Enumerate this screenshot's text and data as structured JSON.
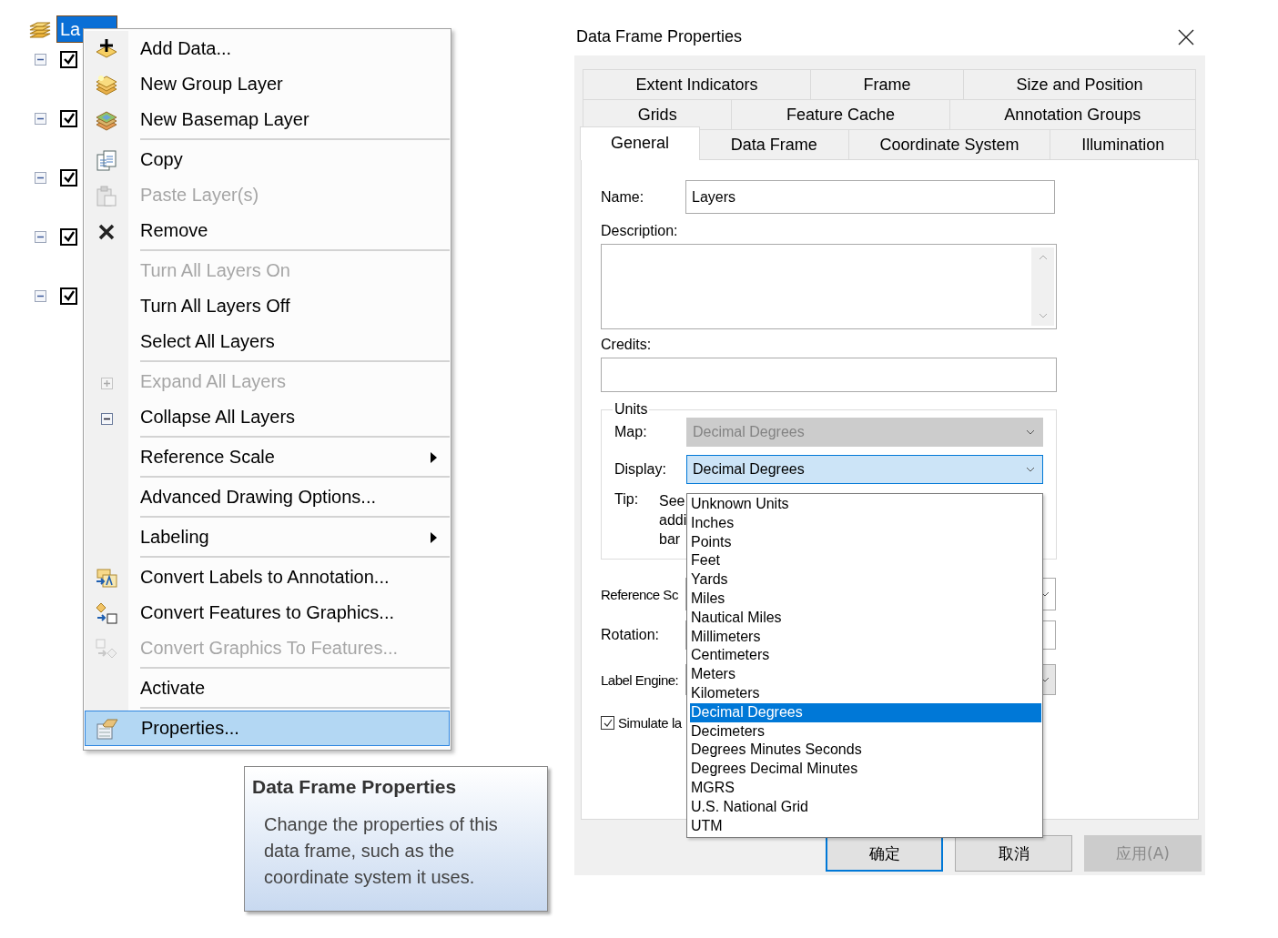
{
  "tree": {
    "root": {
      "label": "La",
      "selected": true
    },
    "layers": [
      {
        "expanded": true,
        "checked": true
      },
      {
        "expanded": true,
        "checked": true
      },
      {
        "expanded": true,
        "checked": true
      },
      {
        "expanded": true,
        "checked": true
      },
      {
        "expanded": true,
        "checked": true
      }
    ]
  },
  "context_menu": {
    "items": [
      {
        "kind": "item",
        "label": "Add Data...",
        "disabled": false,
        "selected": false,
        "submenu": false
      },
      {
        "kind": "item",
        "label": "New Group Layer",
        "disabled": false,
        "selected": false,
        "submenu": false
      },
      {
        "kind": "item",
        "label": "New Basemap Layer",
        "disabled": false,
        "selected": false,
        "submenu": false
      },
      {
        "kind": "separator"
      },
      {
        "kind": "item",
        "label": "Copy",
        "disabled": false,
        "selected": false,
        "submenu": false
      },
      {
        "kind": "item",
        "label": "Paste Layer(s)",
        "disabled": true,
        "selected": false,
        "submenu": false
      },
      {
        "kind": "item",
        "label": "Remove",
        "disabled": false,
        "selected": false,
        "submenu": false
      },
      {
        "kind": "separator"
      },
      {
        "kind": "item",
        "label": "Turn All Layers On",
        "disabled": true,
        "selected": false,
        "submenu": false
      },
      {
        "kind": "item",
        "label": "Turn All Layers Off",
        "disabled": false,
        "selected": false,
        "submenu": false
      },
      {
        "kind": "item",
        "label": "Select All Layers",
        "disabled": false,
        "selected": false,
        "submenu": false
      },
      {
        "kind": "separator"
      },
      {
        "kind": "item",
        "label": "Expand All Layers",
        "disabled": true,
        "selected": false,
        "submenu": false
      },
      {
        "kind": "item",
        "label": "Collapse All Layers",
        "disabled": false,
        "selected": false,
        "submenu": false
      },
      {
        "kind": "separator"
      },
      {
        "kind": "item",
        "label": "Reference Scale",
        "disabled": false,
        "selected": false,
        "submenu": true
      },
      {
        "kind": "separator"
      },
      {
        "kind": "item",
        "label": "Advanced Drawing Options...",
        "disabled": false,
        "selected": false,
        "submenu": false
      },
      {
        "kind": "separator"
      },
      {
        "kind": "item",
        "label": "Labeling",
        "disabled": false,
        "selected": false,
        "submenu": true
      },
      {
        "kind": "separator"
      },
      {
        "kind": "item",
        "label": "Convert Labels to Annotation...",
        "disabled": false,
        "selected": false,
        "submenu": false
      },
      {
        "kind": "item",
        "label": "Convert Features to Graphics...",
        "disabled": false,
        "selected": false,
        "submenu": false
      },
      {
        "kind": "item",
        "label": "Convert Graphics To Features...",
        "disabled": true,
        "selected": false,
        "submenu": false
      },
      {
        "kind": "separator"
      },
      {
        "kind": "item",
        "label": "Activate",
        "disabled": false,
        "selected": false,
        "submenu": false
      },
      {
        "kind": "separator"
      },
      {
        "kind": "item",
        "label": "Properties...",
        "disabled": false,
        "selected": true,
        "submenu": false
      }
    ]
  },
  "tooltip": {
    "title": "Data Frame Properties",
    "text": "Change the properties of this data frame, such as the coordinate system it uses."
  },
  "dialog": {
    "title": "Data Frame Properties",
    "tab_rows": [
      [
        {
          "label": "Extent Indicators",
          "selected": false
        },
        {
          "label": "Frame",
          "selected": false
        },
        {
          "label": "Size and Position",
          "selected": false
        }
      ],
      [
        {
          "label": "Grids",
          "selected": false
        },
        {
          "label": "Feature Cache",
          "selected": false
        },
        {
          "label": "Annotation Groups",
          "selected": false
        }
      ],
      [
        {
          "label": "General",
          "selected": true
        },
        {
          "label": "Data Frame",
          "selected": false
        },
        {
          "label": "Coordinate System",
          "selected": false
        },
        {
          "label": "Illumination",
          "selected": false
        }
      ]
    ],
    "general": {
      "name_label": "Name:",
      "name_value": "Layers",
      "description_label": "Description:",
      "credits_label": "Credits:",
      "units": {
        "legend": "Units",
        "map_label": "Map:",
        "map_value": "Decimal Degrees",
        "map_disabled": true,
        "display_label": "Display:",
        "display_value": "Decimal Degrees",
        "display_expanded": true,
        "tip_label": "Tip:",
        "tip_lines": [
          "See",
          "addi",
          "bar"
        ]
      },
      "reference_scale_label": "Reference Sc",
      "rotation_label": "Rotation:",
      "label_engine_label": "Label Engine:",
      "simulate": {
        "label": "Simulate la",
        "checked": true
      }
    },
    "dropdown_options": [
      {
        "label": "Unknown Units",
        "selected": false
      },
      {
        "label": "Inches",
        "selected": false
      },
      {
        "label": "Points",
        "selected": false
      },
      {
        "label": "Feet",
        "selected": false
      },
      {
        "label": "Yards",
        "selected": false
      },
      {
        "label": "Miles",
        "selected": false
      },
      {
        "label": "Nautical Miles",
        "selected": false
      },
      {
        "label": "Millimeters",
        "selected": false
      },
      {
        "label": "Centimeters",
        "selected": false
      },
      {
        "label": "Meters",
        "selected": false
      },
      {
        "label": "Kilometers",
        "selected": false
      },
      {
        "label": "Decimal Degrees",
        "selected": true
      },
      {
        "label": "Decimeters",
        "selected": false
      },
      {
        "label": "Degrees Minutes Seconds",
        "selected": false
      },
      {
        "label": "Degrees Decimal Minutes",
        "selected": false
      },
      {
        "label": "MGRS",
        "selected": false
      },
      {
        "label": "U.S. National Grid",
        "selected": false
      },
      {
        "label": "UTM",
        "selected": false
      }
    ],
    "buttons": [
      {
        "label": "确定",
        "default": true,
        "disabled": false
      },
      {
        "label": "取消",
        "default": false,
        "disabled": false
      },
      {
        "label": "应用(A)",
        "default": false,
        "disabled": true
      }
    ]
  }
}
